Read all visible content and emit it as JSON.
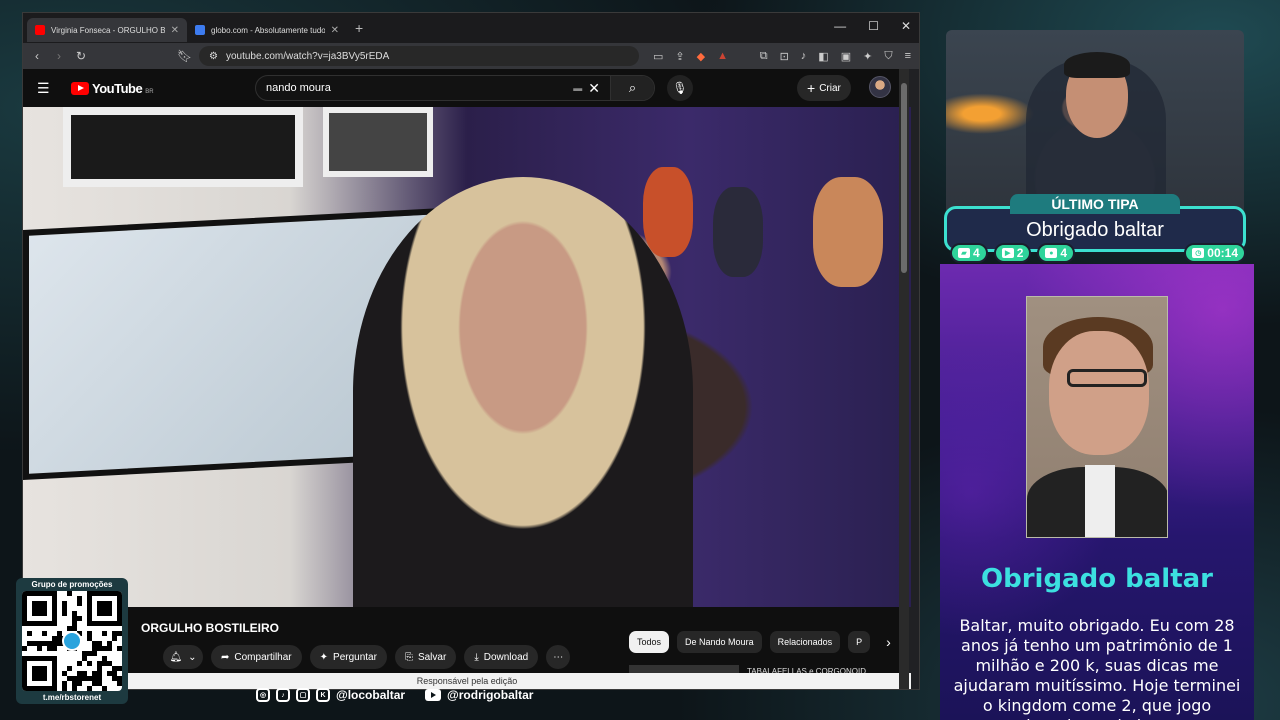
{
  "browser": {
    "tabs": [
      {
        "title": "Virginia Fonseca - ORGULHO BOSTILEIRO",
        "active": true,
        "favicon_color": "#ff0000"
      },
      {
        "title": "globo.com - Absolutamente tudo sobre notícias",
        "active": false,
        "favicon_color": "#3d7cf0"
      }
    ],
    "url": "youtube.com/watch?v=ja3BVy5rEDA",
    "status_text": "Responsável pela edição"
  },
  "youtube": {
    "logo_text": "YouTube",
    "country_code": "BR",
    "search_value": "nando moura",
    "create_label": "Criar",
    "video_title": "ORGULHO BOSTILEIRO",
    "actions": {
      "share": "Compartilhar",
      "ask": "Perguntar",
      "save": "Salvar",
      "download": "Download"
    },
    "chips": [
      "Todos",
      "De Nando Moura",
      "Relacionados",
      "P"
    ],
    "next_video_title": "TABALAFELLAS e CORGONOID..."
  },
  "overlay": {
    "promo_title": "Grupo de promoções",
    "promo_link": "t.me/rbstorenet",
    "social_handle_1": "@locobaltar",
    "social_handle_2": "@rodrigobaltar",
    "tip_banner": "ÚLTIMO TIPA",
    "tip_name": "Obrigado baltar",
    "stats": [
      {
        "icon": "chat-icon",
        "value": "4"
      },
      {
        "icon": "video-icon",
        "value": "2"
      },
      {
        "icon": "mic-icon",
        "value": "4"
      }
    ],
    "timer": "00:14",
    "message_title": "Obrigado baltar",
    "message_body": "Baltar, muito obrigado. Eu com 28 anos já tenho um patrimônio de 1 milhão e 200 k, suas dicas me ajudaram muitíssimo. Hoje terminei o kingdom come 2, que jogo absurdo, pude jogar"
  },
  "colors": {
    "accent_cyan": "#3ce0cf",
    "stat_green": "#2fd49b",
    "yt_red": "#ff0000"
  }
}
